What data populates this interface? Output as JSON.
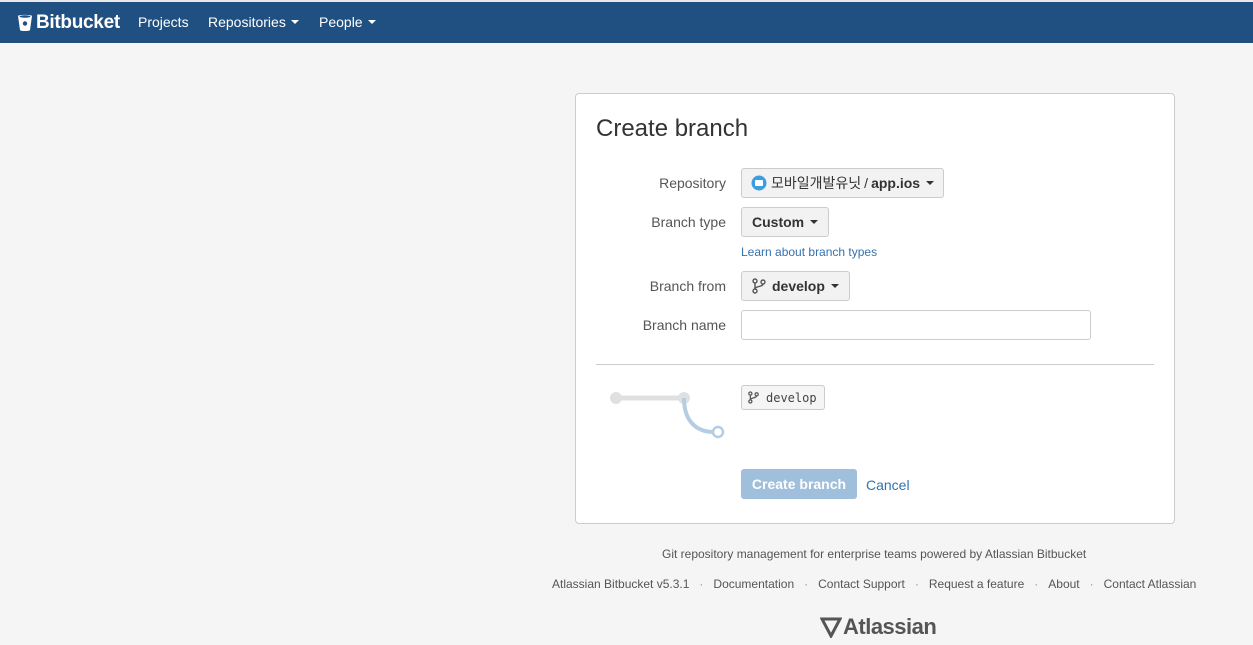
{
  "header": {
    "brand": "Bitbucket",
    "nav": {
      "projects": "Projects",
      "repositories": "Repositories",
      "people": "People"
    }
  },
  "form": {
    "title": "Create branch",
    "repository_label": "Repository",
    "repository_project": "모바일개발유닛",
    "repository_separator": "/",
    "repository_name": "app.ios",
    "branch_type_label": "Branch type",
    "branch_type_value": "Custom",
    "learn_link": "Learn about branch types",
    "branch_from_label": "Branch from",
    "branch_from_value": "develop",
    "branch_name_label": "Branch name",
    "branch_name_value": "",
    "preview_branch": "develop",
    "submit_label": "Create branch",
    "cancel_label": "Cancel"
  },
  "footer": {
    "tagline": "Git repository management for enterprise teams powered by Atlassian Bitbucket",
    "links": [
      "Atlassian Bitbucket v5.3.1",
      "Documentation",
      "Contact Support",
      "Request a feature",
      "About",
      "Contact Atlassian"
    ],
    "logo_text": "Atlassian"
  },
  "colors": {
    "header_bg": "#205081",
    "link": "#3572b0",
    "primary_disabled": "#a0bfdc",
    "graph_line": "#e0e0e0",
    "graph_branch": "#b5cde3"
  }
}
